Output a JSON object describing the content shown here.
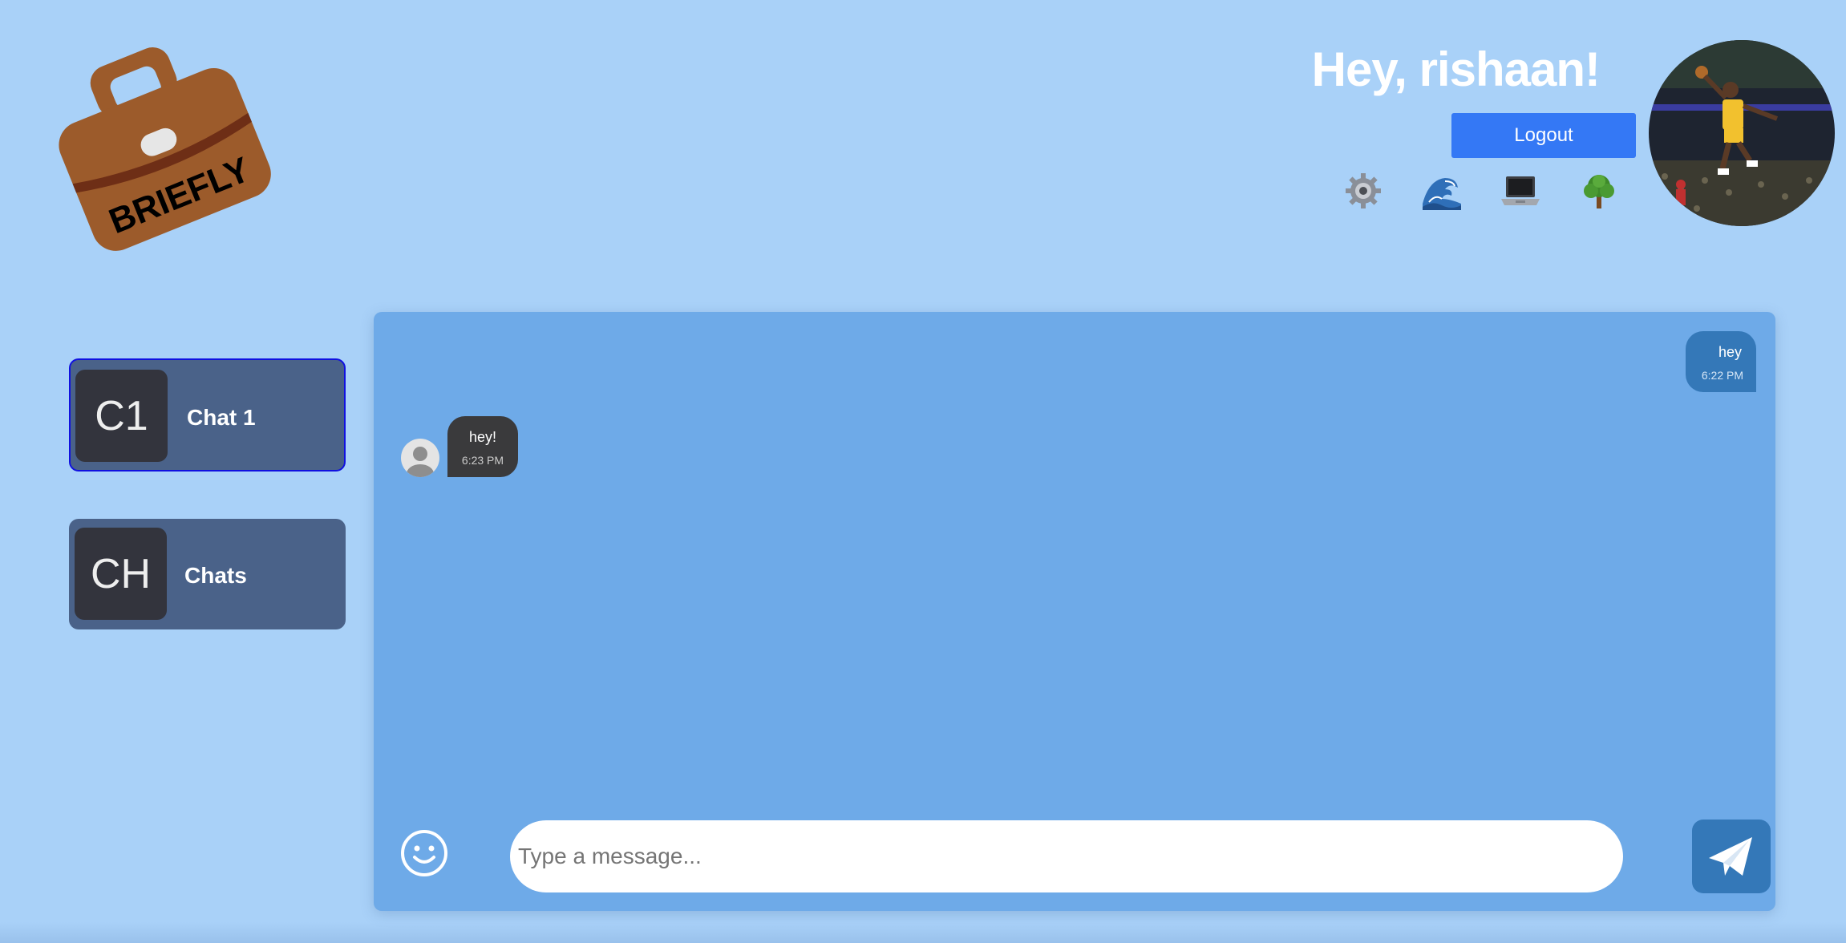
{
  "app": {
    "logo_text": "BRIEFLY",
    "logo_icon": "briefcase-icon"
  },
  "header": {
    "greeting": "Hey, rishaan!",
    "logout_label": "Logout",
    "themes": [
      {
        "name": "gear",
        "icon": "gear-icon"
      },
      {
        "name": "wave",
        "icon": "wave-icon"
      },
      {
        "name": "laptop",
        "icon": "laptop-icon"
      },
      {
        "name": "tree",
        "icon": "tree-icon"
      }
    ],
    "profile_picture": "user-avatar"
  },
  "sidebar": {
    "chats": [
      {
        "initials": "C1",
        "name": "Chat 1",
        "active": true
      },
      {
        "initials": "CH",
        "name": "Chats",
        "active": false
      }
    ]
  },
  "conversation": {
    "messages": [
      {
        "direction": "outgoing",
        "text": "hey",
        "time": "6:22 PM"
      },
      {
        "direction": "incoming",
        "text": "hey!",
        "time": "6:23 PM"
      }
    ]
  },
  "composer": {
    "placeholder": "Type a message...",
    "value": "",
    "emoji_icon": "smiley-icon",
    "send_icon": "paper-plane-icon"
  },
  "colors": {
    "background": "#a9d1f8",
    "panel": "#6eaae8",
    "accent": "#3478f5",
    "outgoing_bubble": "#3478b8",
    "incoming_bubble": "#3a3a3c",
    "chat_card": "#4a6289"
  }
}
